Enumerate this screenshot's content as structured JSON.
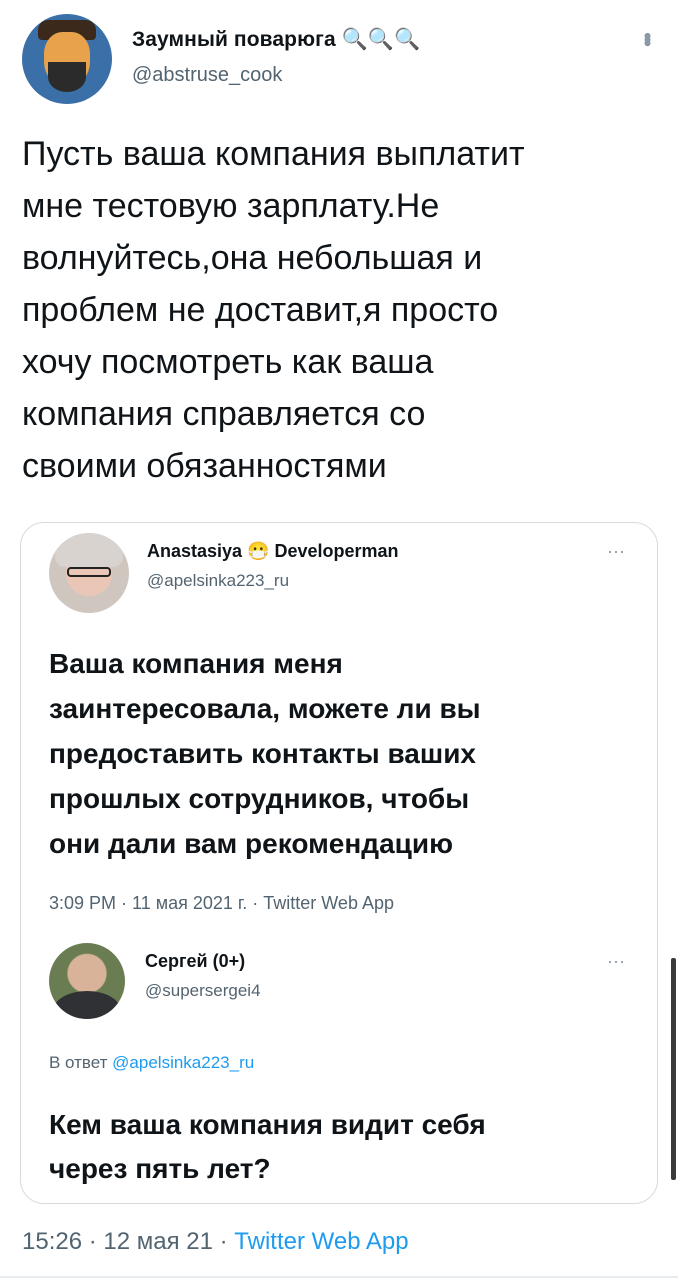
{
  "tweet": {
    "author": {
      "display_name": "Заумный поварюга",
      "name_emojis": "🔍🔍🔍",
      "handle": "@abstruse_cook"
    },
    "more_icon": "kebab-icon",
    "text": "Пусть ваша компания выплатит\nмне тестовую зарплату.Не\nволнуйтесь,она небольшая и\nпроблем не доставит,я просто\nхочу посмотреть как ваша\nкомпания справляется со\nсвоими обязанностями",
    "timestamp": "15:26 · 12 мая 21 · ",
    "source": "Twitter Web App"
  },
  "quoted": {
    "original": {
      "display_name": "Anastasiya 😷 Developerman",
      "handle": "@apelsinka223_ru",
      "text": "Ваша компания меня\nзаинтересовала, можете ли вы\nпредоставить контакты ваших\nпрошлых сотрудников, чтобы\nони дали вам рекомендацию",
      "meta": "3:09 PM · 11 мая 2021 г. · Twitter Web App",
      "more": "···"
    },
    "reply": {
      "display_name": "Сергей (0+)",
      "handle": "@supersergei4",
      "replying_prefix": "В ответ ",
      "replying_handle": "@apelsinka223_ru",
      "text": "Кем ваша компания видит себя\nчерез пять лет?",
      "more": "···"
    }
  },
  "colors": {
    "text": "#0f1419",
    "secondary": "#536471",
    "link": "#1d9bf0",
    "border": "#d5dbe0"
  }
}
